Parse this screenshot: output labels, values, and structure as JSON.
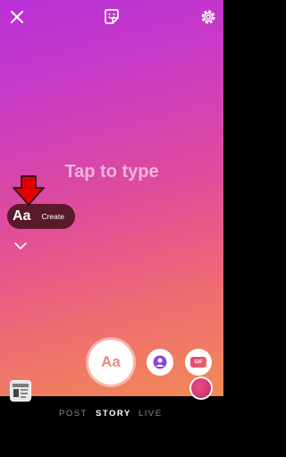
{
  "canvas": {
    "placeholder": "Tap to type",
    "text_style_button": {
      "label": "Aa",
      "create": "Create"
    }
  },
  "capture_button": {
    "label": "Aa"
  },
  "modes": {
    "post": "POST",
    "story": "STORY",
    "live": "LIVE"
  },
  "gif_label": "GIF",
  "colors": {
    "gradient_top": "#b82fd6",
    "gradient_bottom": "#f28a55",
    "pill": "#5a1a2c",
    "annotation_arrow": "#e00000"
  },
  "icons": [
    "close-icon",
    "sticker-icon",
    "settings-icon",
    "chevron-down-icon",
    "mention-icon",
    "gif-icon",
    "gallery-thumbnail",
    "color-picker-icon"
  ]
}
